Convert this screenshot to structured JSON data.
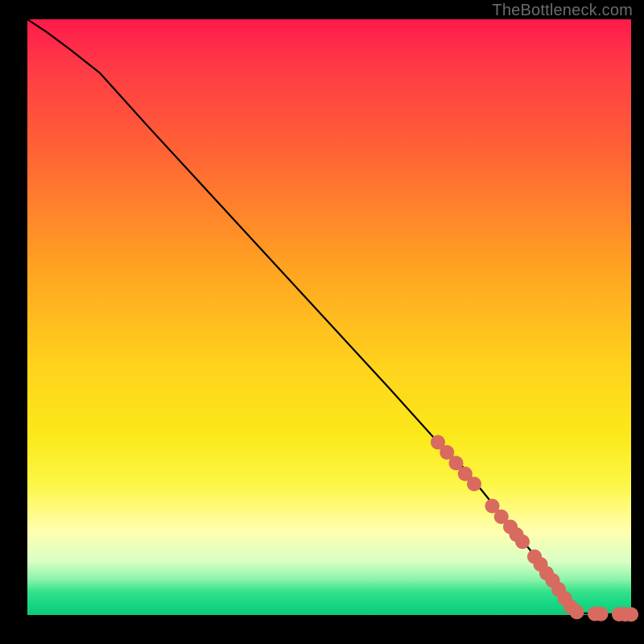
{
  "attribution": "TheBottleneck.com",
  "chart_data": {
    "type": "line",
    "title": "",
    "xlabel": "",
    "ylabel": "",
    "xlim": [
      0,
      100
    ],
    "ylim": [
      0,
      100
    ],
    "legend": false,
    "curve": {
      "x": [
        0,
        3,
        7,
        12,
        20,
        30,
        40,
        50,
        60,
        68,
        72,
        76,
        80,
        84,
        87,
        89,
        90,
        92,
        94,
        96,
        98,
        100
      ],
      "y": [
        100,
        98,
        95,
        91,
        82,
        71,
        60,
        49,
        38,
        29,
        25,
        20,
        15,
        10,
        6,
        3,
        1.2,
        0.3,
        0.2,
        0.15,
        0.12,
        0.1
      ]
    },
    "markers": {
      "note": "salmon circle markers indicating data points along lower-right tail",
      "radius_px": 9,
      "color": "#d86a60",
      "points": [
        {
          "x": 68,
          "y": 29
        },
        {
          "x": 69.5,
          "y": 27.3
        },
        {
          "x": 71,
          "y": 25.5
        },
        {
          "x": 72.5,
          "y": 23.7
        },
        {
          "x": 74,
          "y": 22
        },
        {
          "x": 77,
          "y": 18.3
        },
        {
          "x": 78.5,
          "y": 16.5
        },
        {
          "x": 80,
          "y": 14.8
        },
        {
          "x": 81,
          "y": 13.5
        },
        {
          "x": 82,
          "y": 12.3
        },
        {
          "x": 84,
          "y": 9.8
        },
        {
          "x": 85,
          "y": 8.5
        },
        {
          "x": 86,
          "y": 7
        },
        {
          "x": 87,
          "y": 5.8
        },
        {
          "x": 88,
          "y": 4.3
        },
        {
          "x": 89,
          "y": 2.8
        },
        {
          "x": 90,
          "y": 1.4
        },
        {
          "x": 91,
          "y": 0.5
        },
        {
          "x": 94,
          "y": 0.2
        },
        {
          "x": 95,
          "y": 0.18
        },
        {
          "x": 98,
          "y": 0.14
        },
        {
          "x": 99,
          "y": 0.12
        },
        {
          "x": 100,
          "y": 0.1
        }
      ]
    }
  }
}
